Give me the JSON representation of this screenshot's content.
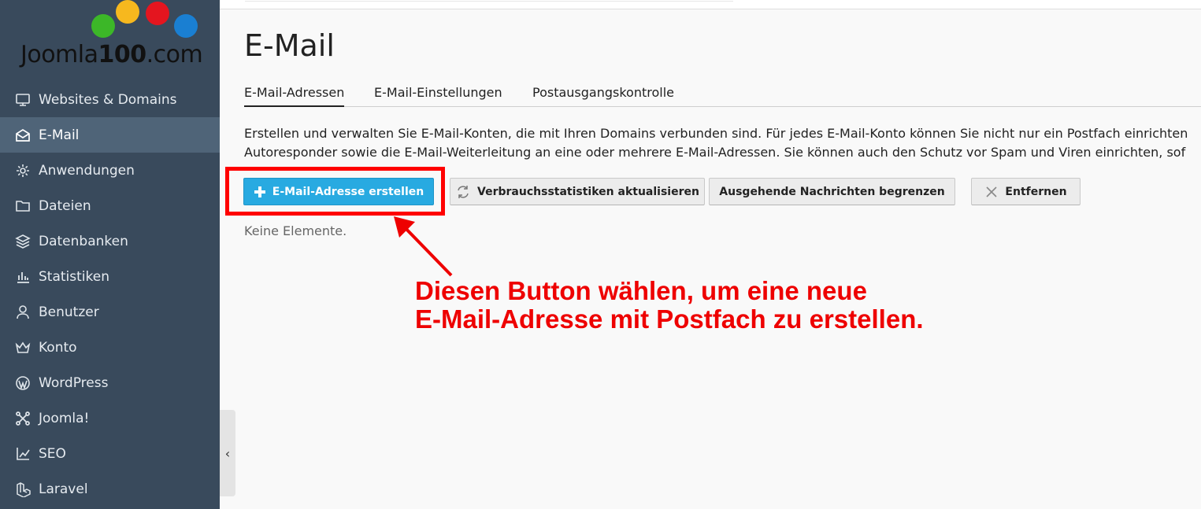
{
  "logo": {
    "text_main": "Joomla",
    "text_num": "100",
    "text_suffix": ".com",
    "dot_colors": [
      "#3cb728",
      "#f6b81e",
      "#e4151f",
      "#1a7fd2"
    ]
  },
  "sidebar": {
    "items": [
      {
        "label": "Websites & Domains",
        "icon": "monitor-icon"
      },
      {
        "label": "E-Mail",
        "icon": "mail-icon",
        "active": true
      },
      {
        "label": "Anwendungen",
        "icon": "gear-icon"
      },
      {
        "label": "Dateien",
        "icon": "folder-icon"
      },
      {
        "label": "Datenbanken",
        "icon": "layers-icon"
      },
      {
        "label": "Statistiken",
        "icon": "bar-chart-icon"
      },
      {
        "label": "Benutzer",
        "icon": "user-icon"
      },
      {
        "label": "Konto",
        "icon": "crown-icon"
      },
      {
        "label": "WordPress",
        "icon": "wordpress-icon"
      },
      {
        "label": "Joomla!",
        "icon": "joomla-icon"
      },
      {
        "label": "SEO",
        "icon": "trend-chart-icon"
      },
      {
        "label": "Laravel",
        "icon": "laravel-icon"
      }
    ],
    "collapse_glyph": "‹"
  },
  "main": {
    "title": "E-Mail",
    "tabs": [
      {
        "label": "E-Mail-Adressen"
      },
      {
        "label": "E-Mail-Einstellungen"
      },
      {
        "label": "Postausgangskontrolle"
      }
    ],
    "description_line1": "Erstellen und verwalten Sie E-Mail-Konten, die mit Ihren Domains verbunden sind. Für jedes E-Mail-Konto können Sie nicht nur ein Postfach einrichten",
    "description_line2": "Autoresponder sowie die E-Mail-Weiterleitung an eine oder mehrere E-Mail-Adressen. Sie können auch den Schutz vor Spam und Viren einrichten, sof",
    "buttons": {
      "create": "E-Mail-Adresse erstellen",
      "update_stats": "Verbrauchsstatistiken aktualisieren",
      "limit": "Ausgehende Nachrichten begrenzen",
      "remove": "Entfernen"
    },
    "empty_text": "Keine Elemente."
  },
  "annotation": {
    "line1": "Diesen Button wählen, um eine neue",
    "line2": "E-Mail-Adresse mit Postfach zu erstellen.",
    "color": "#ee0000"
  },
  "colors": {
    "sidebar_bg": "#394a5c",
    "sidebar_active": "#4f6478",
    "primary_button": "#28aae1",
    "highlight": "#ff0000"
  }
}
